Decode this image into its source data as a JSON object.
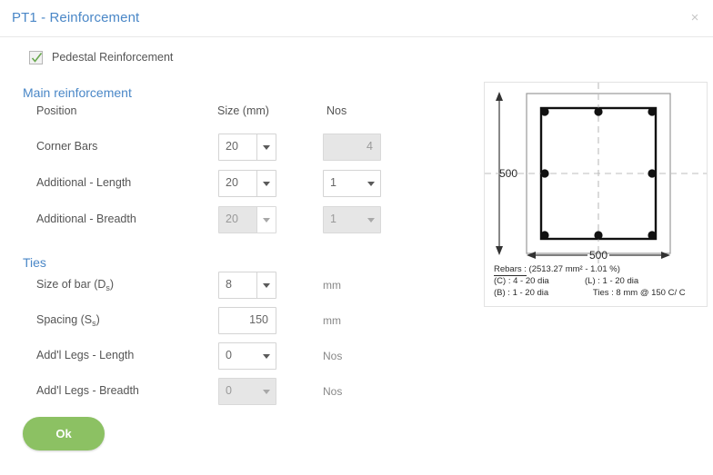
{
  "header": {
    "title": "PT1 - Reinforcement",
    "close_label": "×"
  },
  "pedestal": {
    "label": "Pedestal Reinforcement",
    "checked": true
  },
  "sections": {
    "main": {
      "heading": "Main reinforcement",
      "columns": {
        "position": "Position",
        "size": "Size (mm)",
        "nos": "Nos"
      },
      "rows": [
        {
          "label": "Corner Bars",
          "size_value": "20",
          "size_disabled": false,
          "nos_value": "4",
          "nos_type": "text",
          "nos_disabled": true
        },
        {
          "label": "Additional - Length",
          "size_value": "20",
          "size_disabled": false,
          "nos_value": "1",
          "nos_type": "select",
          "nos_disabled": false
        },
        {
          "label": "Additional - Breadth",
          "size_value": "20",
          "size_disabled": true,
          "nos_value": "1",
          "nos_type": "select",
          "nos_disabled": true
        }
      ]
    },
    "ties": {
      "heading": "Ties",
      "rows": [
        {
          "label_main": "Size of bar (D",
          "label_sub": "s",
          "label_tail": ")",
          "value": "8",
          "type": "select",
          "disabled": false,
          "unit": "mm"
        },
        {
          "label_main": "Spacing (S",
          "label_sub": "s",
          "label_tail": ")",
          "value": "150",
          "type": "text",
          "disabled": false,
          "unit": "mm"
        },
        {
          "label_main": "Add'l Legs - Length",
          "label_sub": "",
          "label_tail": "",
          "value": "0",
          "type": "select-inline",
          "disabled": false,
          "unit": "Nos"
        },
        {
          "label_main": "Add'l Legs - Breadth",
          "label_sub": "",
          "label_tail": "",
          "value": "0",
          "type": "select-inline",
          "disabled": true,
          "unit": "Nos"
        }
      ]
    }
  },
  "ok_button": {
    "label": "Ok"
  },
  "diagram": {
    "dim_vertical": "500",
    "dim_horizontal": "500",
    "annotation": {
      "rebars_word": "Rebars :",
      "rebars_summary": "(2513.27 mm² - 1.01 %)",
      "corner": "(C) : 4 - 20 dia",
      "length": "(L) : 1 - 20 dia",
      "breadth": "(B) : 1 - 20 dia",
      "ties": "Ties : 8 mm @ 150 C/ C"
    }
  },
  "colors": {
    "accent_blue": "#4a87c7",
    "ok_green": "#8cc163",
    "label_gray": "#555555",
    "border_gray": "#d4d4d4"
  }
}
